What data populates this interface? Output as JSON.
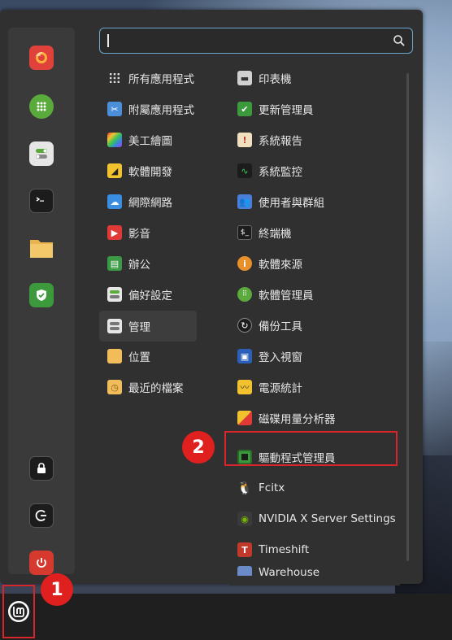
{
  "search": {
    "value": "",
    "placeholder": ""
  },
  "favorites": [
    {
      "icon": "firefox-icon",
      "color": "#e0413a"
    },
    {
      "icon": "software-manager-icon",
      "color": "#5aaa3c"
    },
    {
      "icon": "system-settings-icon",
      "color": "#e6e6e6"
    },
    {
      "icon": "terminal-icon",
      "color": "#2b2b2b"
    },
    {
      "icon": "files-icon",
      "color": "#e6b24e"
    },
    {
      "icon": "update-manager-icon",
      "color": "#3c9a3c"
    },
    {
      "icon": "lock-screen-icon",
      "color": "#2b2b2b"
    },
    {
      "icon": "logout-icon",
      "color": "#2b2b2b"
    },
    {
      "icon": "shutdown-icon",
      "color": "#d63a2e"
    }
  ],
  "categories": [
    {
      "label": "所有應用程式"
    },
    {
      "label": "附屬應用程式"
    },
    {
      "label": "美工繪圖"
    },
    {
      "label": "軟體開發"
    },
    {
      "label": "網際網路"
    },
    {
      "label": "影音"
    },
    {
      "label": "辦公"
    },
    {
      "label": "偏好設定"
    },
    {
      "label": "管理"
    },
    {
      "label": "位置"
    },
    {
      "label": "最近的檔案"
    }
  ],
  "apps": [
    {
      "label": "印表機"
    },
    {
      "label": "更新管理員"
    },
    {
      "label": "系統報告"
    },
    {
      "label": "系統監控"
    },
    {
      "label": "使用者與群組"
    },
    {
      "label": "終端機"
    },
    {
      "label": "軟體來源"
    },
    {
      "label": "軟體管理員"
    },
    {
      "label": "備份工具"
    },
    {
      "label": "登入視窗"
    },
    {
      "label": "電源統計"
    },
    {
      "label": "磁碟用量分析器"
    },
    {
      "label": "驅動程式管理員"
    },
    {
      "label": "Fcitx"
    },
    {
      "label": "NVIDIA X Server Settings"
    },
    {
      "label": "Timeshift"
    },
    {
      "label": "Warehouse"
    }
  ],
  "annotations": {
    "badge1": "1",
    "badge2": "2",
    "highlight_color": "#d6262b"
  }
}
